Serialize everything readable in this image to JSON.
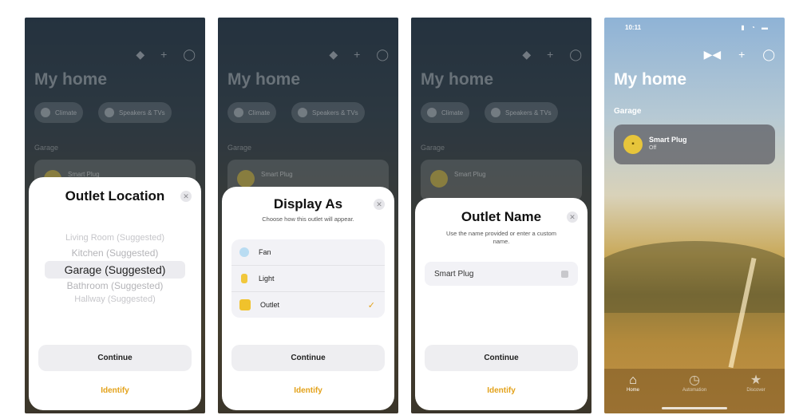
{
  "background_home": {
    "title": "My home",
    "section": "Garage",
    "device_name": "Smart Plug",
    "device_status": "Off",
    "chip1_label": "Climate",
    "chip2_label": "Speakers & TVs"
  },
  "screen1": {
    "title": "Outlet Location",
    "rooms": [
      "Living Room (Suggested)",
      "Kitchen (Suggested)",
      "Garage (Suggested)",
      "Bathroom (Suggested)",
      "Hallway (Suggested)"
    ],
    "selected_index": 2,
    "continue_label": "Continue",
    "identify_label": "Identify"
  },
  "screen2": {
    "title": "Display As",
    "subtitle": "Choose how this outlet will appear.",
    "options": [
      {
        "label": "Fan",
        "icon": "fan-icon",
        "color": "#b9dcf2"
      },
      {
        "label": "Light",
        "icon": "lightbulb-icon",
        "color": "#f1c73c"
      },
      {
        "label": "Outlet",
        "icon": "outlet-icon",
        "color": "#f0c22c",
        "selected": true
      }
    ],
    "continue_label": "Continue",
    "identify_label": "Identify"
  },
  "screen3": {
    "title": "Outlet Name",
    "subtitle": "Use the name provided or enter a custom name.",
    "name_value": "Smart Plug",
    "continue_label": "Continue",
    "identify_label": "Identify"
  },
  "screen4": {
    "status_time": "10:11",
    "title": "My home",
    "section": "Garage",
    "device_name": "Smart Plug",
    "device_status": "Off",
    "tabs": [
      {
        "label": "Home",
        "icon": "house-icon"
      },
      {
        "label": "Automation",
        "icon": "clock-icon"
      },
      {
        "label": "Discover",
        "icon": "star-icon"
      }
    ],
    "colors": {
      "accent": "#e3a21a",
      "plug_yellow": "#e7c53b"
    }
  }
}
